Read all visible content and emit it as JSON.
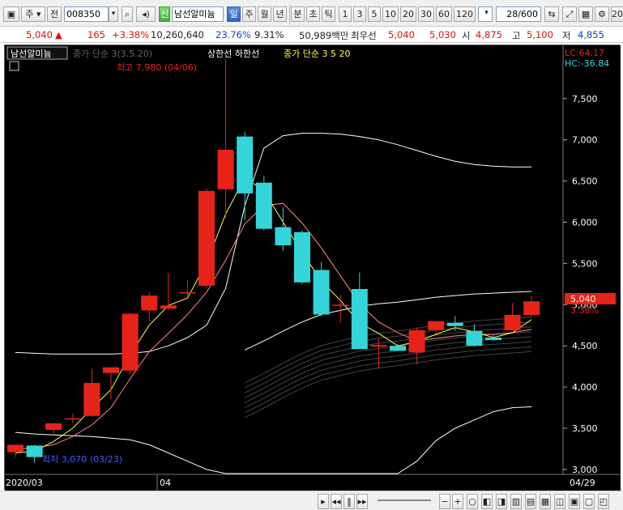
{
  "toolbar": {
    "market": "주",
    "range": "전",
    "code": "008350",
    "credit": "신",
    "stock_name": "남선알미늄",
    "periods": [
      "일",
      "주",
      "월",
      "년"
    ],
    "intraday": [
      "분",
      "초",
      "틱"
    ],
    "intervals": [
      "1",
      "3",
      "5",
      "10",
      "20",
      "30",
      "60",
      "120"
    ],
    "count": "28/600",
    "trailing": "20"
  },
  "quote": {
    "price": "5,040",
    "change_arrow": "▲",
    "change": "165",
    "change_pct": "+3.38%",
    "volume": "10,260,640",
    "rate1": "23.76%",
    "rate2": "9.31%",
    "amount": "50,989백만",
    "best_bid_label": "최우선",
    "best_ask": "5,040",
    "best_bid": "5,030",
    "open_label": "시",
    "open": "4,875",
    "high_label": "고",
    "high": "5,100",
    "low_label": "저",
    "low": "4,855"
  },
  "chart": {
    "name_tag": "남선알미늄",
    "legend_ma": "종가 단순 3(3.5.20)",
    "legend_env": "상한선 하한선",
    "legend_simple": "종가 단순 3 5 20",
    "lc": "LC:64.17",
    "hc": "HC:-36.84",
    "high_note": "최고 7,980 (04/06)",
    "low_note": "최저 3,070 (03/23)",
    "price_now": "5,040",
    "pct_now": "3.38%",
    "x_labels": [
      "2020/03",
      "04",
      "04/29"
    ],
    "y_ticks": [
      "7,500",
      "7,000",
      "6,500",
      "6,000",
      "5,500",
      "5,000",
      "4,500",
      "4,000",
      "3,500",
      "3,000"
    ],
    "colors": {
      "up": "#e8231a",
      "down": "#33d5d9",
      "ma3": "#ffff44",
      "ma5": "#ff8888",
      "ma20": "#ffffff"
    }
  },
  "chart_data": {
    "type": "candlestick",
    "ylim": [
      2950,
      7950
    ],
    "candles": [
      {
        "o": 3210,
        "h": 3300,
        "l": 3150,
        "c": 3300
      },
      {
        "o": 3290,
        "h": 3300,
        "l": 3080,
        "c": 3150
      },
      {
        "o": 3480,
        "h": 3560,
        "l": 3430,
        "c": 3560
      },
      {
        "o": 3620,
        "h": 3680,
        "l": 3560,
        "c": 3620
      },
      {
        "o": 3650,
        "h": 4220,
        "l": 3640,
        "c": 4050
      },
      {
        "o": 4170,
        "h": 4220,
        "l": 3850,
        "c": 4240
      },
      {
        "o": 4200,
        "h": 4900,
        "l": 4150,
        "c": 4890
      },
      {
        "o": 4930,
        "h": 5150,
        "l": 4800,
        "c": 5110
      },
      {
        "o": 4950,
        "h": 5380,
        "l": 4930,
        "c": 4990
      },
      {
        "o": 5150,
        "h": 5300,
        "l": 5100,
        "c": 5150
      },
      {
        "o": 5230,
        "h": 6410,
        "l": 5200,
        "c": 6380
      },
      {
        "o": 6400,
        "h": 7980,
        "l": 6050,
        "c": 6880
      },
      {
        "o": 7040,
        "h": 7100,
        "l": 6020,
        "c": 6350
      },
      {
        "o": 6480,
        "h": 6560,
        "l": 5900,
        "c": 5920
      },
      {
        "o": 5940,
        "h": 6180,
        "l": 5650,
        "c": 5720
      },
      {
        "o": 5880,
        "h": 5900,
        "l": 5250,
        "c": 5270
      },
      {
        "o": 5420,
        "h": 5520,
        "l": 4860,
        "c": 4880
      },
      {
        "o": 4990,
        "h": 5120,
        "l": 4780,
        "c": 5000
      },
      {
        "o": 5190,
        "h": 5390,
        "l": 4470,
        "c": 4460
      },
      {
        "o": 4490,
        "h": 4590,
        "l": 4220,
        "c": 4510
      },
      {
        "o": 4500,
        "h": 4520,
        "l": 4440,
        "c": 4440
      },
      {
        "o": 4420,
        "h": 4720,
        "l": 4280,
        "c": 4690
      },
      {
        "o": 4690,
        "h": 4800,
        "l": 4650,
        "c": 4800
      },
      {
        "o": 4780,
        "h": 4860,
        "l": 4680,
        "c": 4740
      },
      {
        "o": 4680,
        "h": 4760,
        "l": 4490,
        "c": 4500
      },
      {
        "o": 4600,
        "h": 4630,
        "l": 4560,
        "c": 4570
      },
      {
        "o": 4690,
        "h": 5020,
        "l": 4680,
        "c": 4875
      },
      {
        "o": 4875,
        "h": 5100,
        "l": 4855,
        "c": 5040
      }
    ],
    "ma3": [
      3200,
      3220,
      3340,
      3500,
      3740,
      3970,
      4390,
      4750,
      4990,
      5080,
      5510,
      6100,
      6540,
      6380,
      6000,
      5630,
      5290,
      5050,
      4780,
      4650,
      4500,
      4550,
      4640,
      4720,
      4670,
      4600,
      4660,
      4820
    ],
    "ma5": [
      3250,
      3260,
      3300,
      3400,
      3540,
      3750,
      4100,
      4430,
      4650,
      4880,
      5150,
      5540,
      5980,
      6200,
      6230,
      5990,
      5690,
      5350,
      5010,
      4790,
      4660,
      4560,
      4590,
      4620,
      4640,
      4640,
      4660,
      4700
    ],
    "ma20": [
      null,
      null,
      null,
      null,
      null,
      null,
      null,
      null,
      null,
      null,
      null,
      null,
      4450,
      4560,
      4680,
      4790,
      4880,
      4930,
      4980,
      5010,
      5030,
      5060,
      5090,
      5110,
      5130,
      5140,
      5150,
      5160
    ],
    "env_upper": [
      4420,
      4410,
      4400,
      4400,
      4400,
      4400,
      4410,
      4430,
      4500,
      4600,
      4750,
      5200,
      6200,
      6900,
      7050,
      7080,
      7080,
      7070,
      7040,
      7000,
      6940,
      6870,
      6800,
      6740,
      6700,
      6680,
      6670,
      6670
    ],
    "env_lower": [
      3450,
      3430,
      3420,
      3410,
      3400,
      3380,
      3360,
      3300,
      3200,
      3100,
      3000,
      2950,
      2950,
      2950,
      2950,
      2950,
      2950,
      2950,
      2950,
      2950,
      2950,
      3100,
      3350,
      3500,
      3600,
      3700,
      3750,
      3760
    ]
  }
}
